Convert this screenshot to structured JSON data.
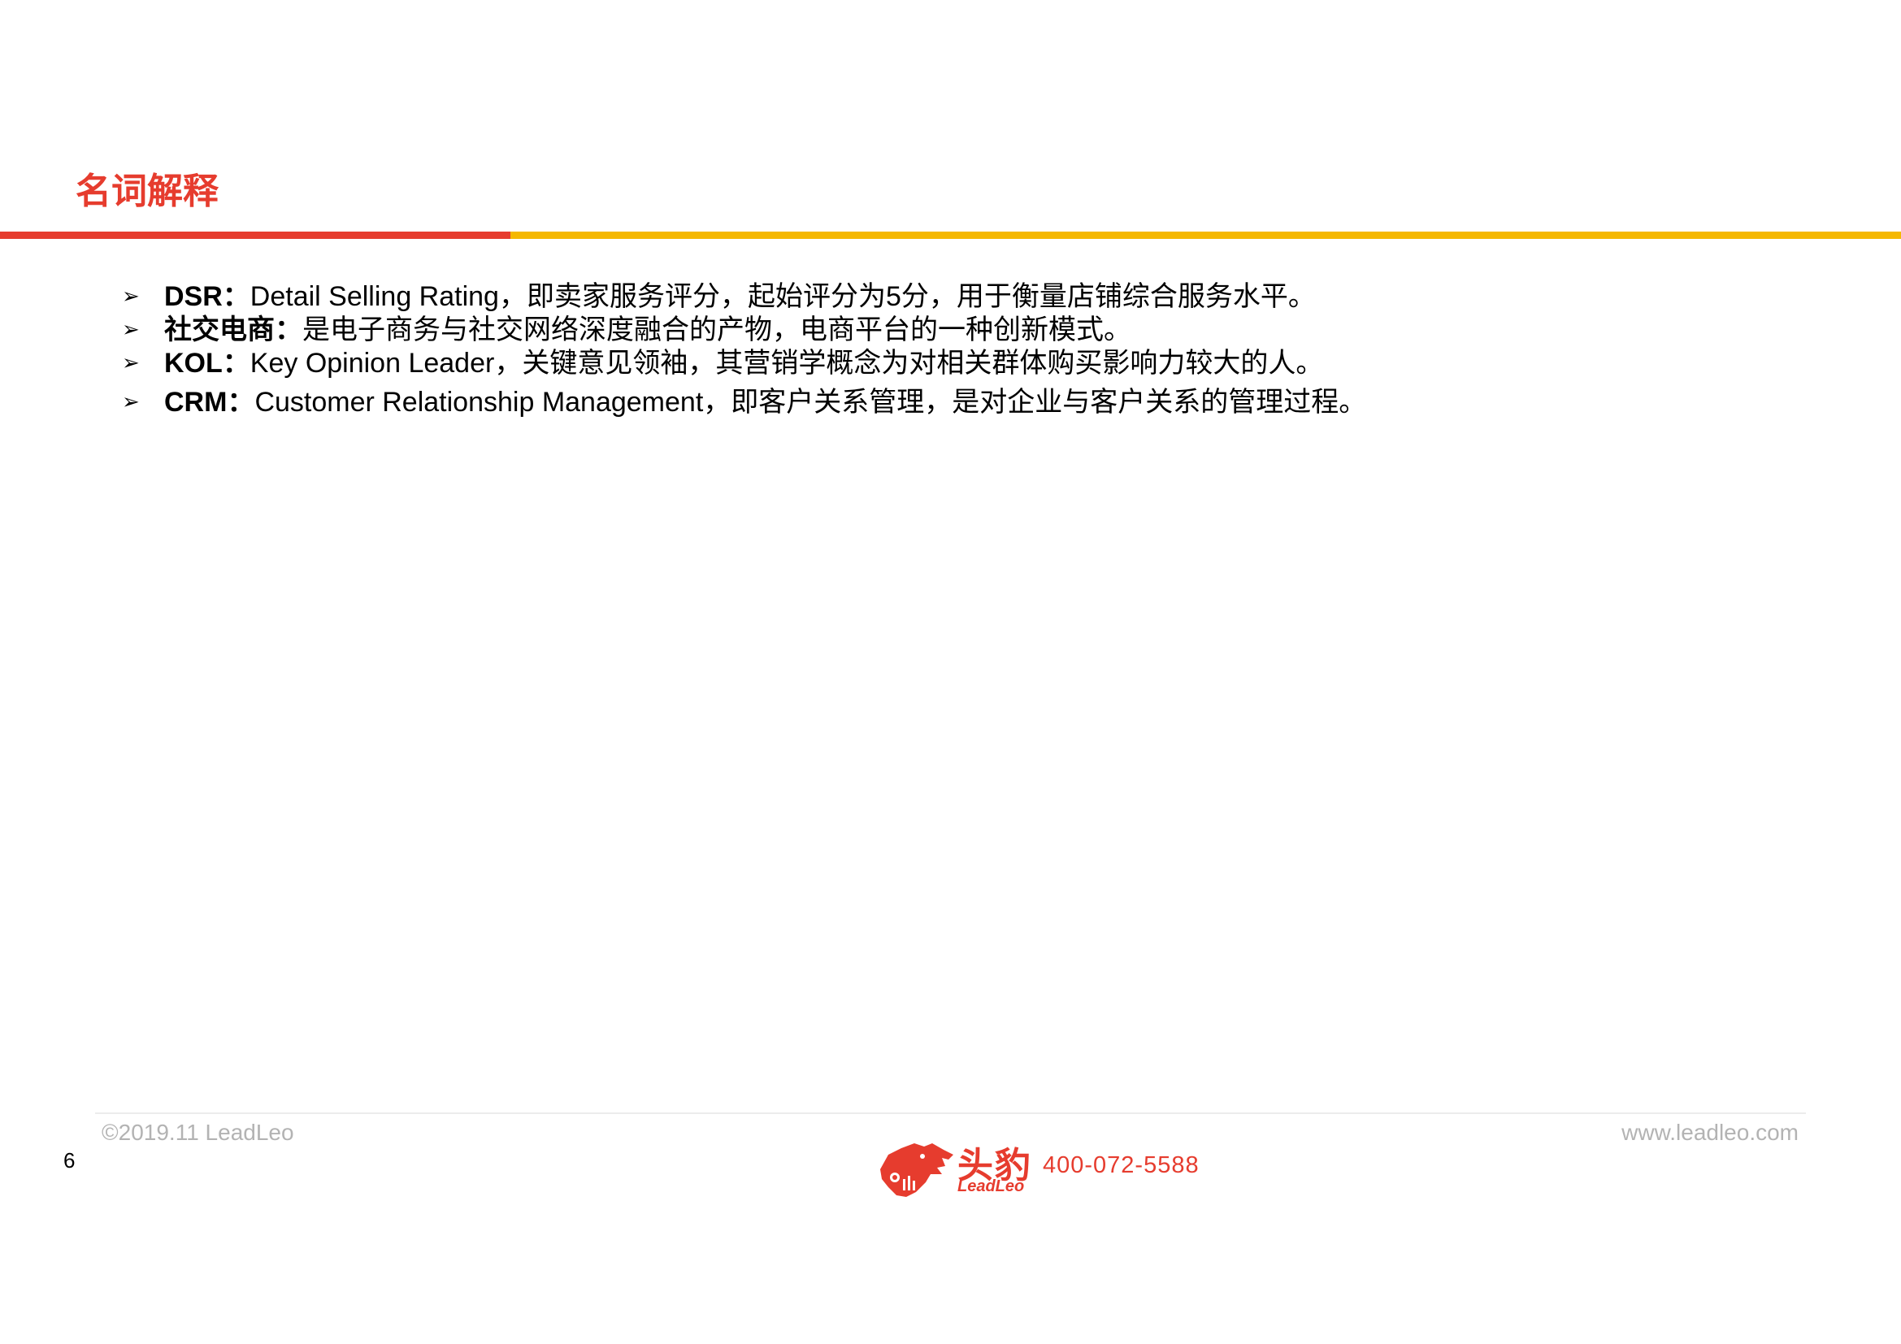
{
  "header": {
    "title": "名词解释",
    "accent_color": "#e63c2e",
    "rule_colors": [
      "#e63c2e",
      "#f5b800"
    ]
  },
  "glossary": {
    "bullet": "➢",
    "items": [
      {
        "term": "DSR：",
        "desc": "Detail Selling Rating，即卖家服务评分，起始评分为5分，用于衡量店铺综合服务水平。"
      },
      {
        "term": "社交电商：",
        "desc": "是电子商务与社交网络深度融合的产物，电商平台的一种创新模式。"
      },
      {
        "term": "KOL：",
        "desc": "Key Opinion Leader，关键意见领袖，其营销学概念为对相关群体购买影响力较大的人。"
      },
      {
        "term": "CRM：",
        "desc": "Customer Relationship Management，即客户关系管理，是对企业与客户关系的管理过程。"
      }
    ]
  },
  "footer": {
    "copyright": "©2019.11 LeadLeo",
    "website": "www.leadleo.com",
    "page_number": "6",
    "logo_cn": "头豹",
    "logo_en": "LeadLeo",
    "logo_icon": "leopard-head-icon",
    "hotline": "400-072-5588"
  }
}
